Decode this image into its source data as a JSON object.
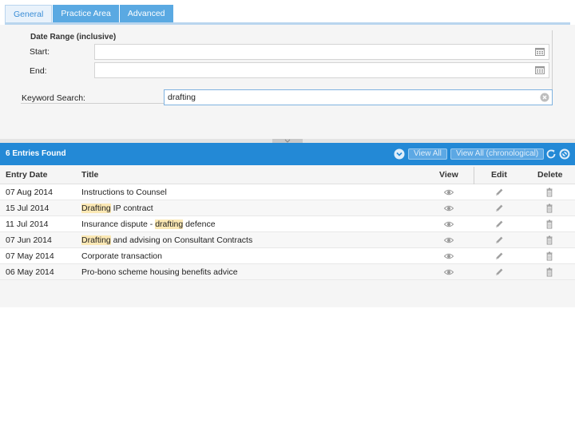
{
  "tabs": [
    {
      "label": "General",
      "active": true
    },
    {
      "label": "Practice Area",
      "active": false
    },
    {
      "label": "Advanced",
      "active": false
    }
  ],
  "filter": {
    "date_range_label": "Date Range (inclusive)",
    "start_label": "Start:",
    "start_value": "",
    "end_label": "End:",
    "end_value": "",
    "keyword_label": "Keyword Search:",
    "keyword_value": "drafting"
  },
  "results": {
    "count_text": "6 Entries Found",
    "view_all_label": "View All",
    "view_all_chrono_label": "View All (chronological)"
  },
  "table": {
    "headers": {
      "entry_date": "Entry Date",
      "title": "Title",
      "view": "View",
      "edit": "Edit",
      "delete": "Delete"
    },
    "rows": [
      {
        "date": "07 Aug 2014",
        "title_pre": "Instructions to Counsel",
        "title_hl": "",
        "title_post": ""
      },
      {
        "date": "15 Jul 2014",
        "title_pre": "",
        "title_hl": "Drafting",
        "title_post": " IP contract"
      },
      {
        "date": "11 Jul 2014",
        "title_pre": "Insurance dispute - ",
        "title_hl": "drafting",
        "title_post": " defence"
      },
      {
        "date": "07 Jun 2014",
        "title_pre": "",
        "title_hl": "Drafting",
        "title_post": " and advising on Consultant Contracts"
      },
      {
        "date": "07 May 2014",
        "title_pre": "Corporate transaction",
        "title_hl": "",
        "title_post": ""
      },
      {
        "date": "06 May 2014",
        "title_pre": "Pro-bono scheme housing benefits advice",
        "title_hl": "",
        "title_post": ""
      }
    ]
  },
  "colors": {
    "header_blue": "#2389d6",
    "tab_blue": "#5aa9e2",
    "highlight": "#fbe8b4"
  },
  "icons": {
    "calendar": "calendar-icon",
    "clear": "clear-input-icon",
    "view": "eye-icon",
    "edit": "pencil-icon",
    "delete": "trash-icon",
    "collapse": "chevron-down-circle-icon",
    "refresh": "refresh-icon",
    "settings": "ban-icon"
  }
}
